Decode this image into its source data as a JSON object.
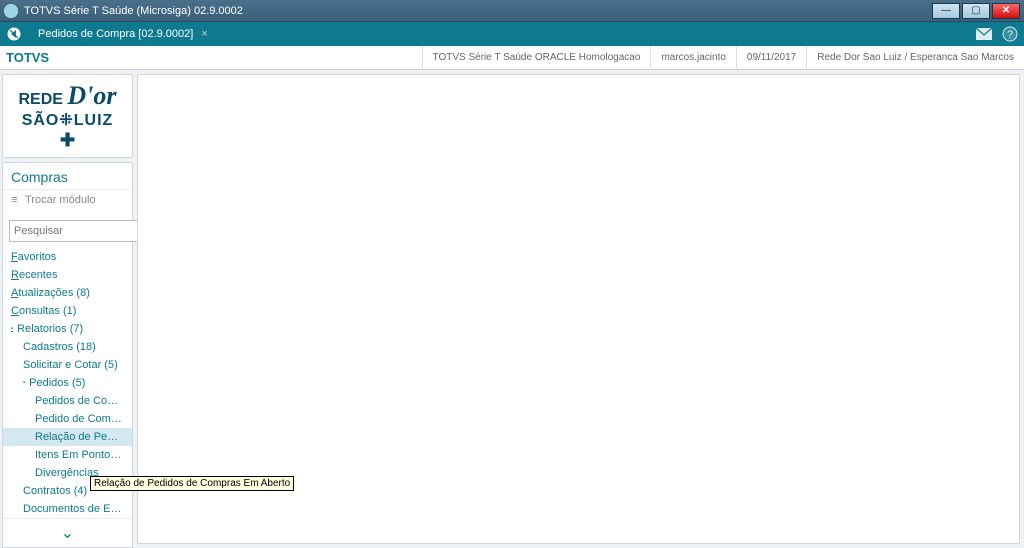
{
  "window": {
    "title": "TOTVS Série T Saúde (Microsiga) 02.9.0002"
  },
  "tab": {
    "label": "Pedidos de Compra [02.9.0002]"
  },
  "brand": "TOTVS",
  "infobar": {
    "env": "TOTVS Série T Saúde ORACLE Homologacao",
    "user": "marcos.jacinto",
    "date": "09/11/2017",
    "org": "Rede Dor Sao Luiz / Esperanca Sao Marcos"
  },
  "logo": {
    "line1a": "REDE ",
    "line1b": "D'or",
    "line2": "SÃO⁜LUIZ",
    "cross": "✚"
  },
  "module": {
    "title": "Compras",
    "switch": "Trocar módulo"
  },
  "search": {
    "placeholder": "Pesquisar"
  },
  "nav": {
    "favoritos": "Favoritos",
    "recentes": "Recentes",
    "atualizacoes": "Atualizações (8)",
    "consultas": "Consultas (1)",
    "relatorios": "Relatorios (7)",
    "cadastros": "Cadastros (18)",
    "solicitar": "Solicitar e Cotar (5)",
    "pedidos": "Pedidos (5)",
    "pedidos_compra": "Pedidos de Compra",
    "pedido_compra_m": "Pedido de Compra M...",
    "relacao_pedidos": "Relação de Pedidos ...",
    "itens_ponto": "Itens Em Ponto de P...",
    "divergencias": "Divergências",
    "contratos": "Contratos (4)",
    "documentos": "Documentos de Entrad..."
  },
  "tooltip": "Relação de Pedidos de Compras Em Aberto"
}
